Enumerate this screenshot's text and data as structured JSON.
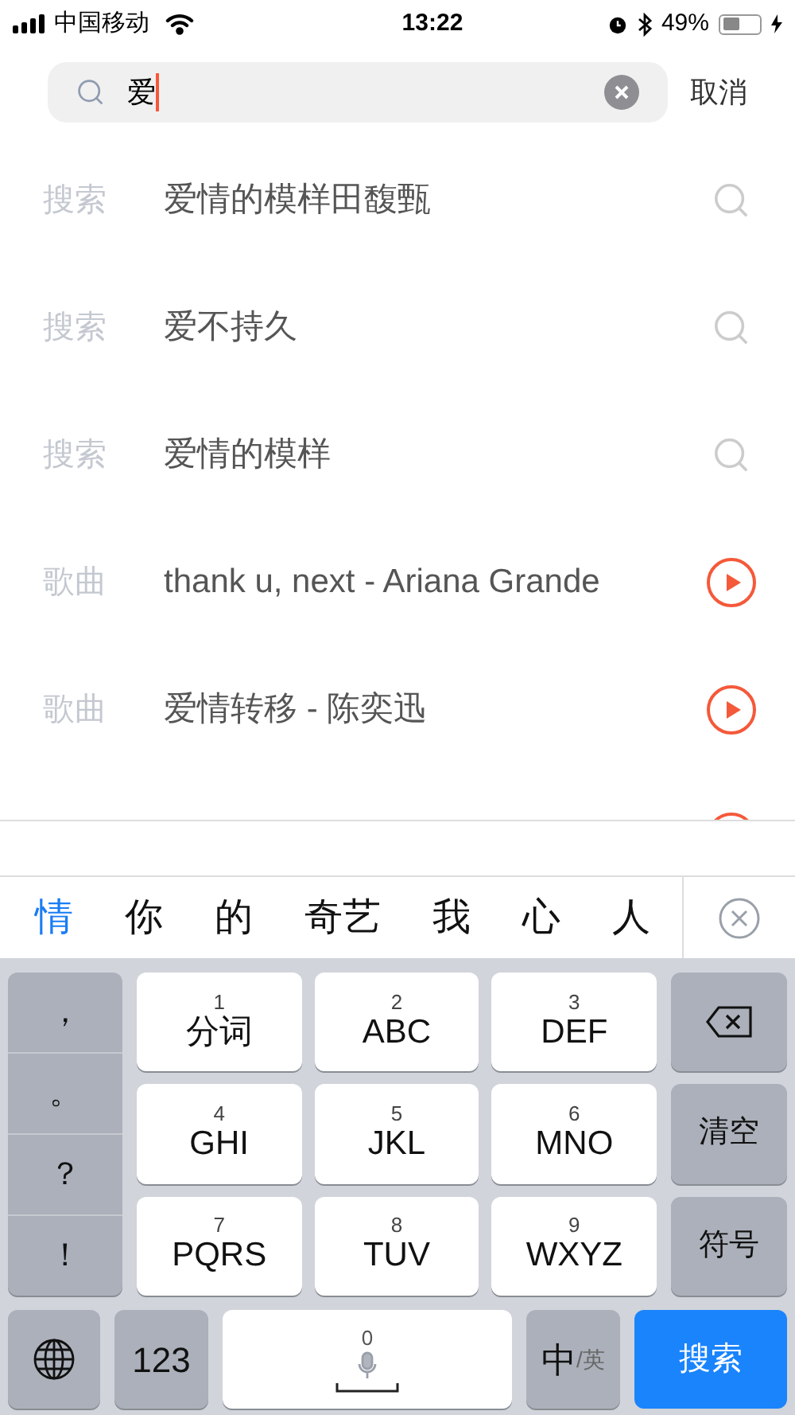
{
  "status_bar": {
    "carrier": "中国移动",
    "time": "13:22",
    "battery": "49%"
  },
  "search": {
    "value": "爱",
    "cancel": "取消"
  },
  "results": [
    {
      "tag": "搜索",
      "text": "爱情的模样田馥甄",
      "kind": "search"
    },
    {
      "tag": "搜索",
      "text": "爱不持久",
      "kind": "search"
    },
    {
      "tag": "搜索",
      "text": "爱情的模样",
      "kind": "search"
    },
    {
      "tag": "歌曲",
      "text": "thank u, next - Ariana Grande",
      "kind": "song"
    },
    {
      "tag": "歌曲",
      "text": "爱情转移 - 陈奕迅",
      "kind": "song"
    }
  ],
  "candidates": [
    {
      "label": "情",
      "selected": true
    },
    {
      "label": "你",
      "selected": false
    },
    {
      "label": "的",
      "selected": false
    },
    {
      "label": "奇艺",
      "selected": false
    },
    {
      "label": "我",
      "selected": false
    },
    {
      "label": "心",
      "selected": false
    },
    {
      "label": "人",
      "selected": false
    }
  ],
  "keyboard": {
    "punctuation": [
      "，",
      "。",
      "？",
      "！"
    ],
    "keys": [
      {
        "number": "1",
        "label": "分词"
      },
      {
        "number": "2",
        "label": "ABC"
      },
      {
        "number": "3",
        "label": "DEF"
      },
      {
        "number": "4",
        "label": "GHI"
      },
      {
        "number": "5",
        "label": "JKL"
      },
      {
        "number": "6",
        "label": "MNO"
      },
      {
        "number": "7",
        "label": "PQRS"
      },
      {
        "number": "8",
        "label": "TUV"
      },
      {
        "number": "9",
        "label": "WXYZ"
      }
    ],
    "clear": "清空",
    "symbols": "符号",
    "numbers": "123",
    "space_number": "0",
    "lang_main": "中",
    "lang_separator": "/",
    "lang_alt": "英",
    "submit": "搜索"
  }
}
